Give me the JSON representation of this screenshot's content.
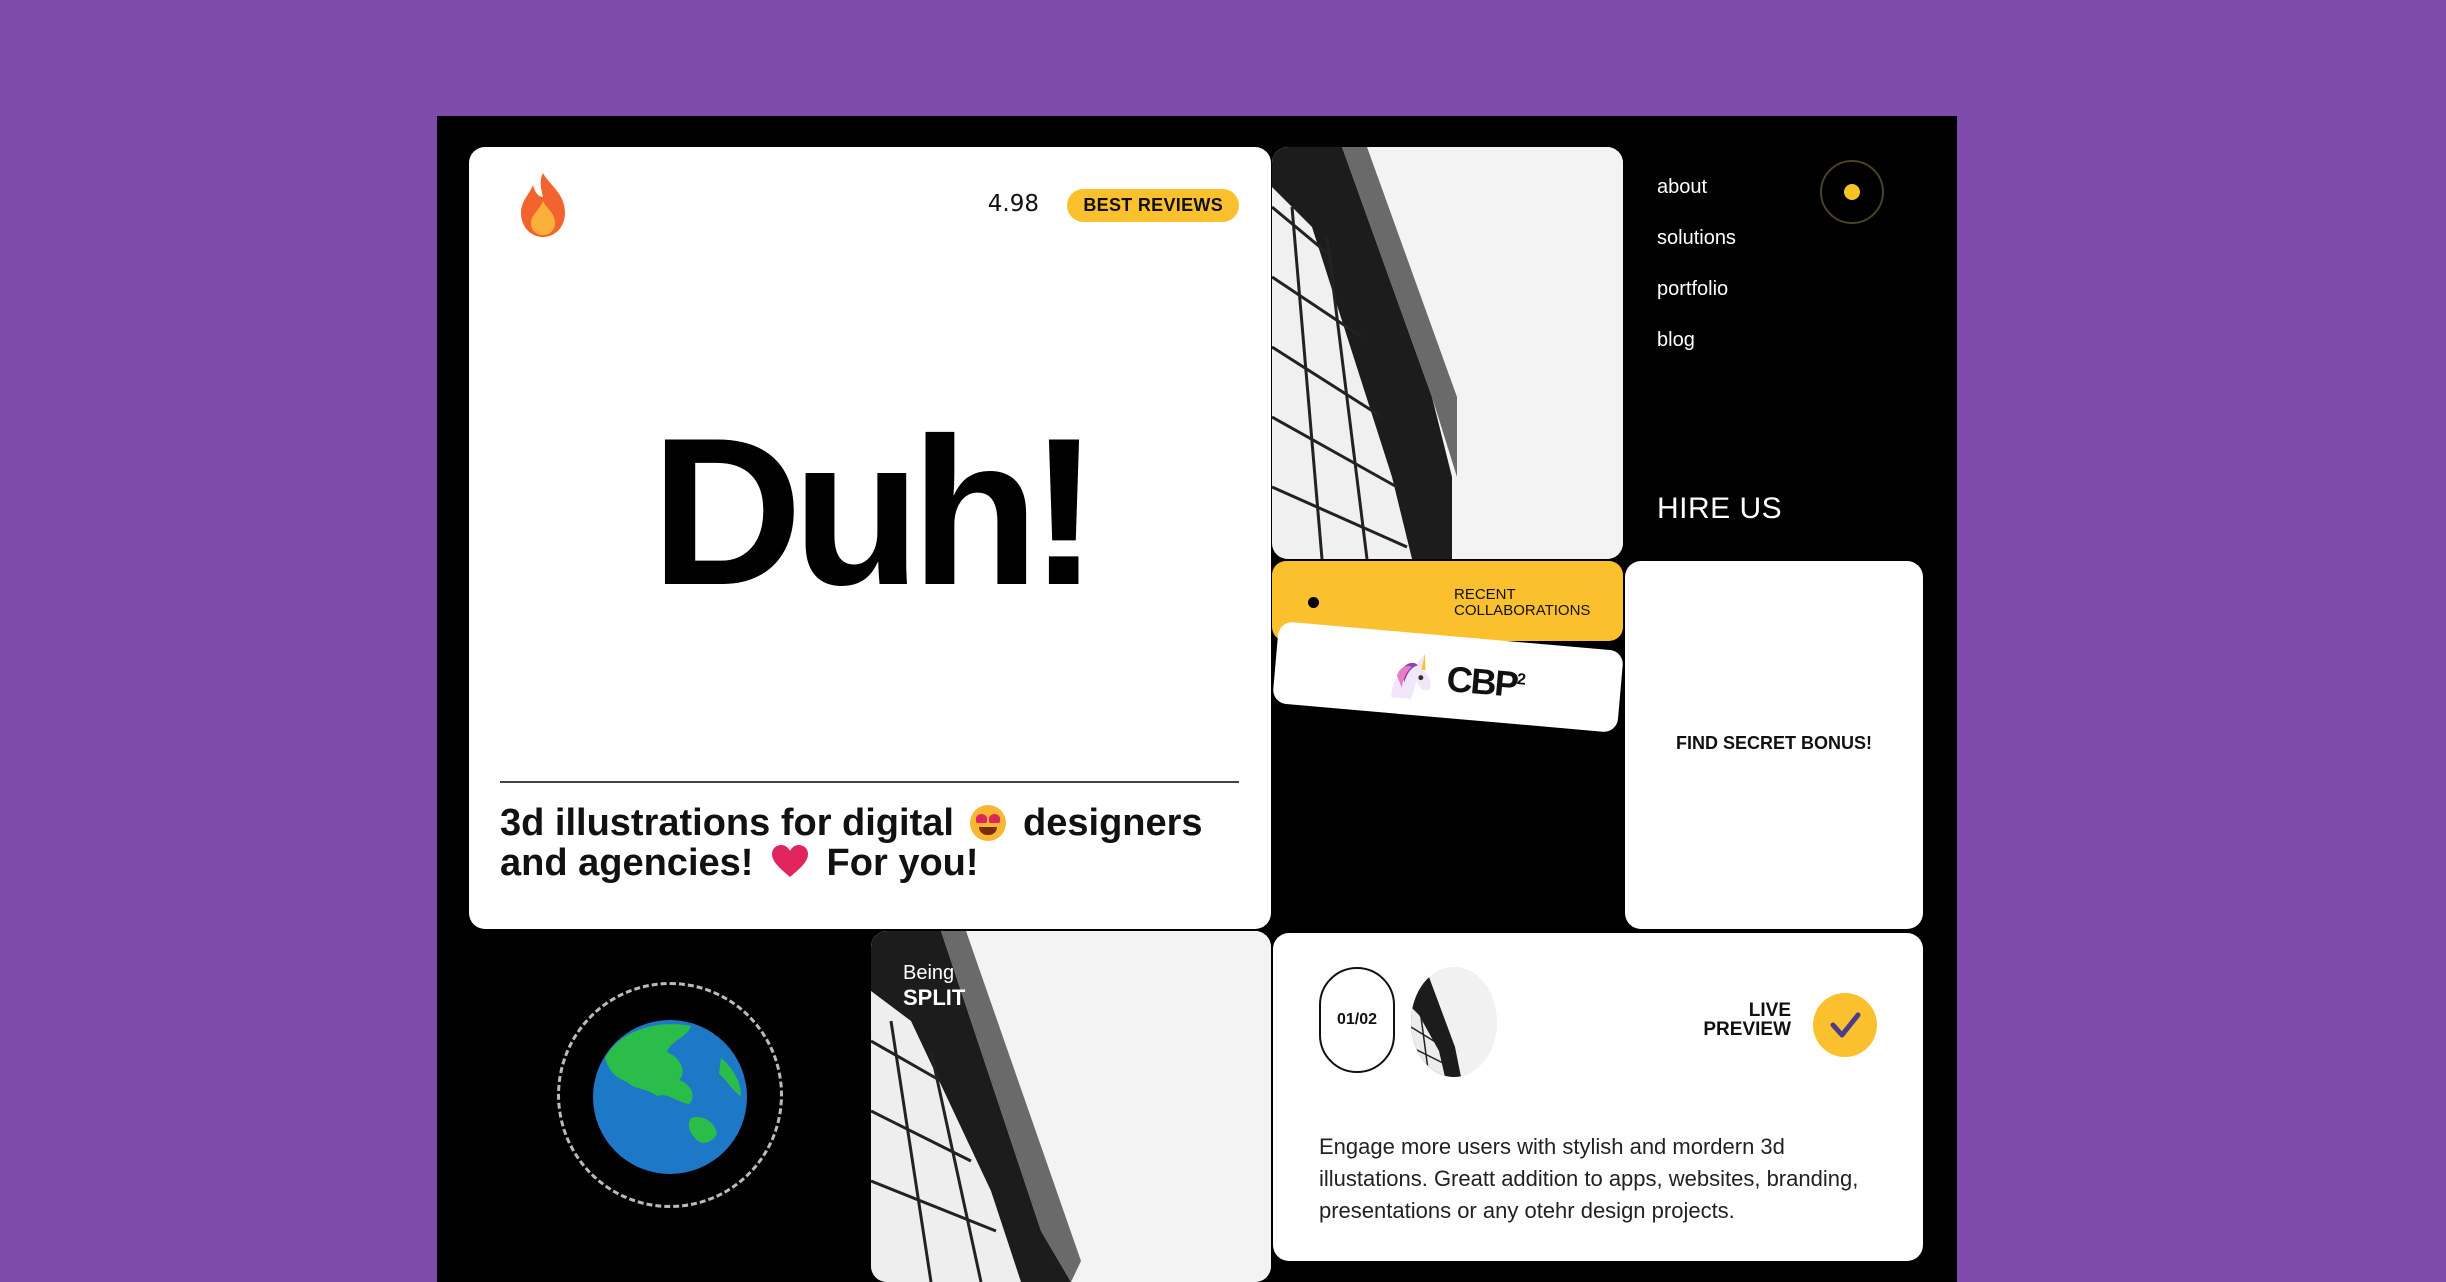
{
  "hero": {
    "rating": "4.98",
    "badge": "BEST REVIEWS",
    "headline": "Duh!",
    "tagline_part1": "3d illustrations for digital",
    "tagline_part2": "designers and agencies!",
    "tagline_part3": "For you!"
  },
  "nav": {
    "items": [
      {
        "label": "about"
      },
      {
        "label": "solutions"
      },
      {
        "label": "portfolio"
      },
      {
        "label": "blog"
      }
    ],
    "hire": "HIRE US"
  },
  "collab": {
    "label_line1": "RECENT",
    "label_line2": "COLLABORATIONS",
    "brand": "CBP",
    "brand_sup": "2"
  },
  "bonus": {
    "label": "FIND SECRET BONUS!"
  },
  "split": {
    "line1": "Being",
    "line2": "SPLIT"
  },
  "live": {
    "counter": "01/02",
    "label_line1": "LIVE",
    "label_line2": "PREVIEW",
    "description": "Engage more users with stylish and mordern 3d illustations. Greatt addition to apps, websites, branding, presentations or any otehr design projects."
  },
  "colors": {
    "background": "#7e4bab",
    "frame": "#000000",
    "accent": "#fbc02d"
  },
  "icons": [
    "flame-icon",
    "heart-eyes-emoji-icon",
    "heart-icon",
    "unicorn-icon",
    "globe-icon",
    "check-icon",
    "dot-menu-icon"
  ]
}
